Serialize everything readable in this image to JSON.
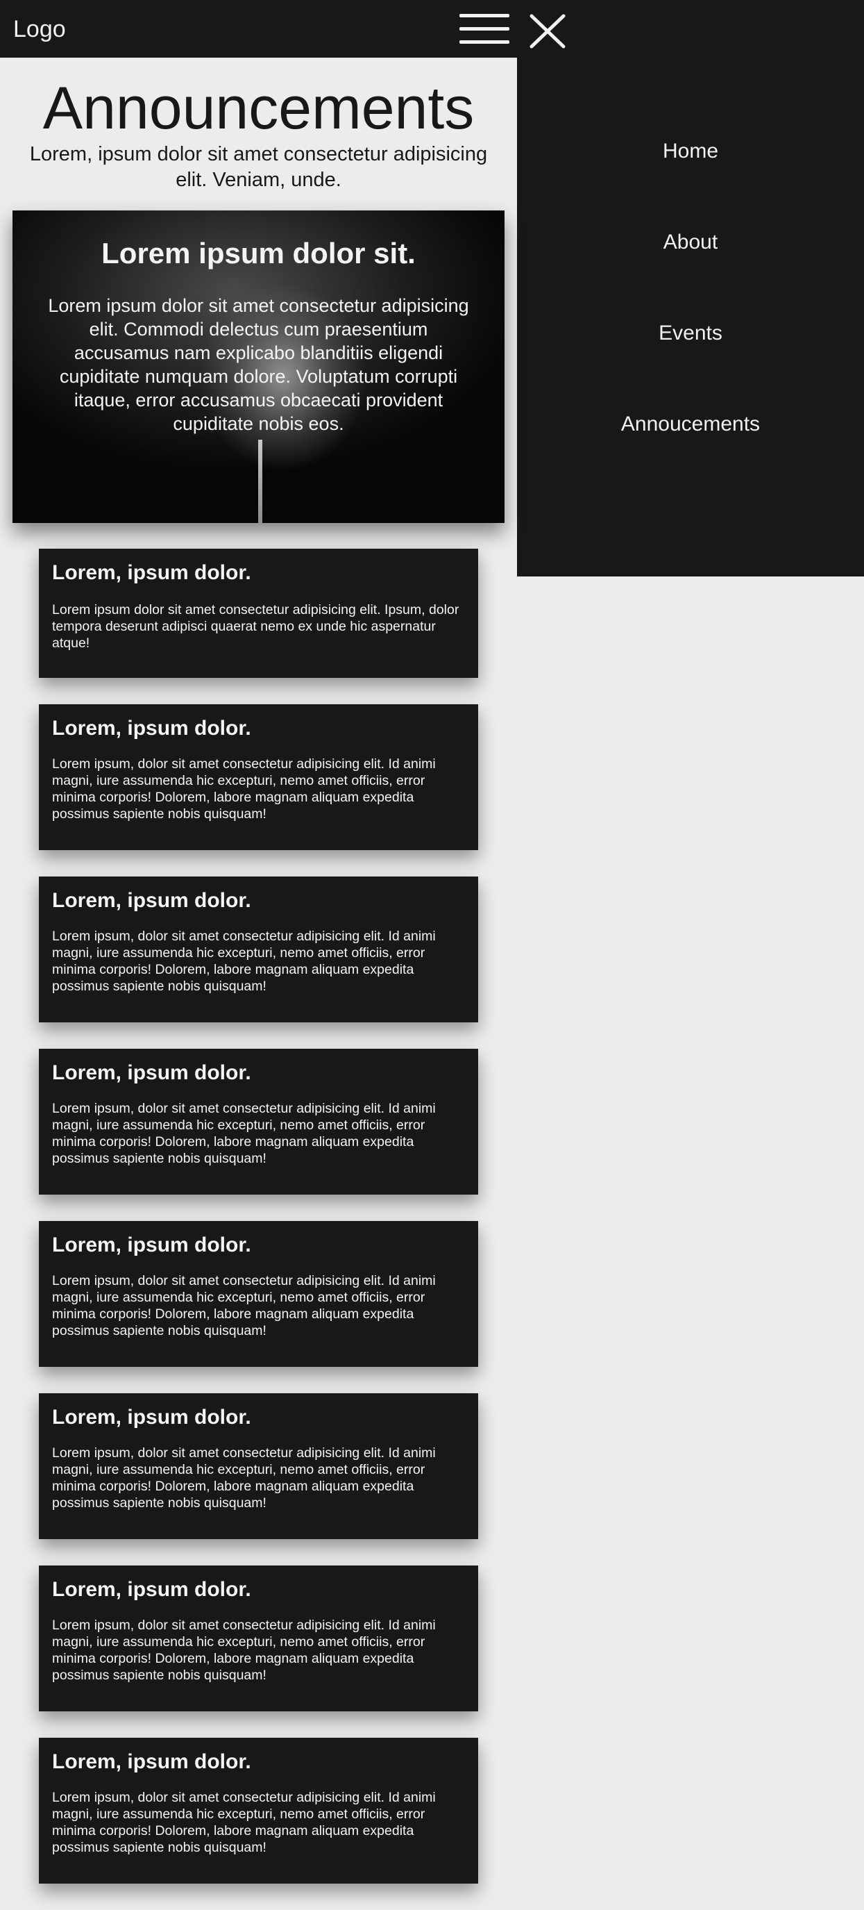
{
  "header": {
    "logo": "Logo",
    "menu_icon": "hamburger-icon",
    "close_icon": "close-icon"
  },
  "nav": {
    "items": [
      {
        "label": "Home"
      },
      {
        "label": "About"
      },
      {
        "label": "Events"
      },
      {
        "label": "Annoucements"
      }
    ]
  },
  "page": {
    "title": "Announcements",
    "subtitle": "Lorem, ipsum dolor sit amet consectetur adipisicing elit. Veniam, unde."
  },
  "hero": {
    "title": "Lorem ipsum dolor sit.",
    "text": "Lorem ipsum dolor sit amet consectetur adipisicing elit. Commodi delectus cum praesentium accusamus nam explicabo blanditiis eligendi cupiditate numquam dolore. Voluptatum corrupti itaque, error accusamus obcaecati provident cupiditate nobis eos."
  },
  "cards": [
    {
      "title": "Lorem, ipsum dolor.",
      "text": "Lorem ipsum dolor sit amet consectetur adipisicing elit. Ipsum, dolor tempora deserunt adipisci quaerat nemo ex unde hic aspernatur atque!"
    },
    {
      "title": "Lorem, ipsum dolor.",
      "text": "Lorem ipsum, dolor sit amet consectetur adipisicing elit. Id animi magni, iure assumenda hic excepturi, nemo amet officiis, error minima corporis! Dolorem, labore magnam aliquam expedita possimus sapiente nobis quisquam!"
    },
    {
      "title": "Lorem, ipsum dolor.",
      "text": "Lorem ipsum, dolor sit amet consectetur adipisicing elit. Id animi magni, iure assumenda hic excepturi, nemo amet officiis, error minima corporis! Dolorem, labore magnam aliquam expedita possimus sapiente nobis quisquam!"
    },
    {
      "title": "Lorem, ipsum dolor.",
      "text": "Lorem ipsum, dolor sit amet consectetur adipisicing elit. Id animi magni, iure assumenda hic excepturi, nemo amet officiis, error minima corporis! Dolorem, labore magnam aliquam expedita possimus sapiente nobis quisquam!"
    },
    {
      "title": "Lorem, ipsum dolor.",
      "text": "Lorem ipsum, dolor sit amet consectetur adipisicing elit. Id animi magni, iure assumenda hic excepturi, nemo amet officiis, error minima corporis! Dolorem, labore magnam aliquam expedita possimus sapiente nobis quisquam!"
    },
    {
      "title": "Lorem, ipsum dolor.",
      "text": "Lorem ipsum, dolor sit amet consectetur adipisicing elit. Id animi magni, iure assumenda hic excepturi, nemo amet officiis, error minima corporis! Dolorem, labore magnam aliquam expedita possimus sapiente nobis quisquam!"
    },
    {
      "title": "Lorem, ipsum dolor.",
      "text": "Lorem ipsum, dolor sit amet consectetur adipisicing elit. Id animi magni, iure assumenda hic excepturi, nemo amet officiis, error minima corporis! Dolorem, labore magnam aliquam expedita possimus sapiente nobis quisquam!"
    },
    {
      "title": "Lorem, ipsum dolor.",
      "text": "Lorem ipsum, dolor sit amet consectetur adipisicing elit. Id animi magni, iure assumenda hic excepturi, nemo amet officiis, error minima corporis! Dolorem, labore magnam aliquam expedita possimus sapiente nobis quisquam!"
    }
  ],
  "colors": {
    "bar": "#181818",
    "page_bg": "#ececec",
    "text_light": "#f4f4f4",
    "text_dark": "#181818"
  }
}
